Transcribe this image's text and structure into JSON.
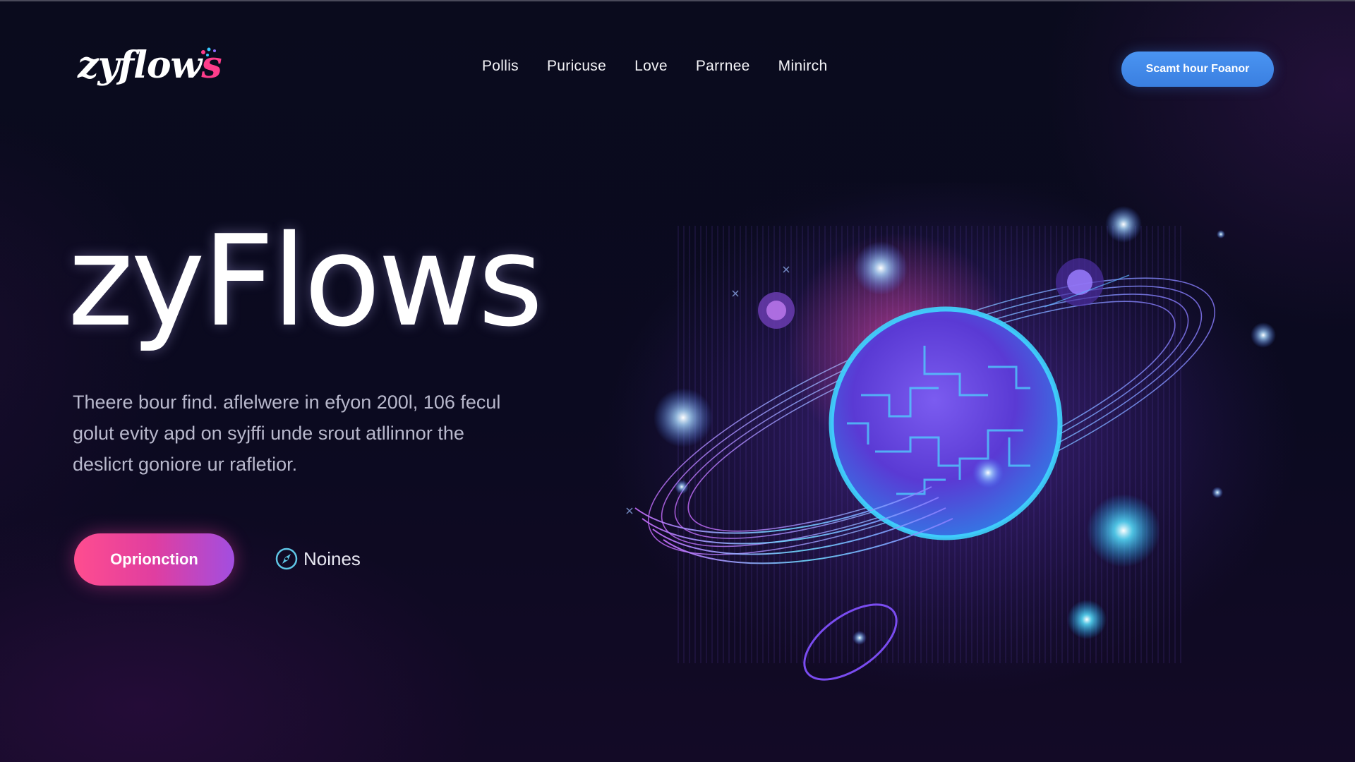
{
  "header": {
    "logo_main": "zyflow",
    "logo_accent": "s",
    "nav": [
      "Pollis",
      "Puricuse",
      "Love",
      "Parrnee",
      "Minirch"
    ],
    "cta_label": "Scamt hour Foanor"
  },
  "hero": {
    "title": "zyFlows",
    "description_lines": [
      "Theere bour find. aflelwere in efyon 200l, 106 fecul",
      "golut evity apd on syjffi unde srout atllinnor the",
      "deslicrt goniore ur rafletior."
    ],
    "primary_button": "Oprionction",
    "secondary_button": "Noines",
    "secondary_icon": "compass-icon"
  },
  "colors": {
    "background": "#0a0a1c",
    "accent_pink": "#ff4d8f",
    "accent_purple": "#a24ee0",
    "cta_blue": "#4a94f2",
    "planet_cyan": "#3fd6ff"
  }
}
